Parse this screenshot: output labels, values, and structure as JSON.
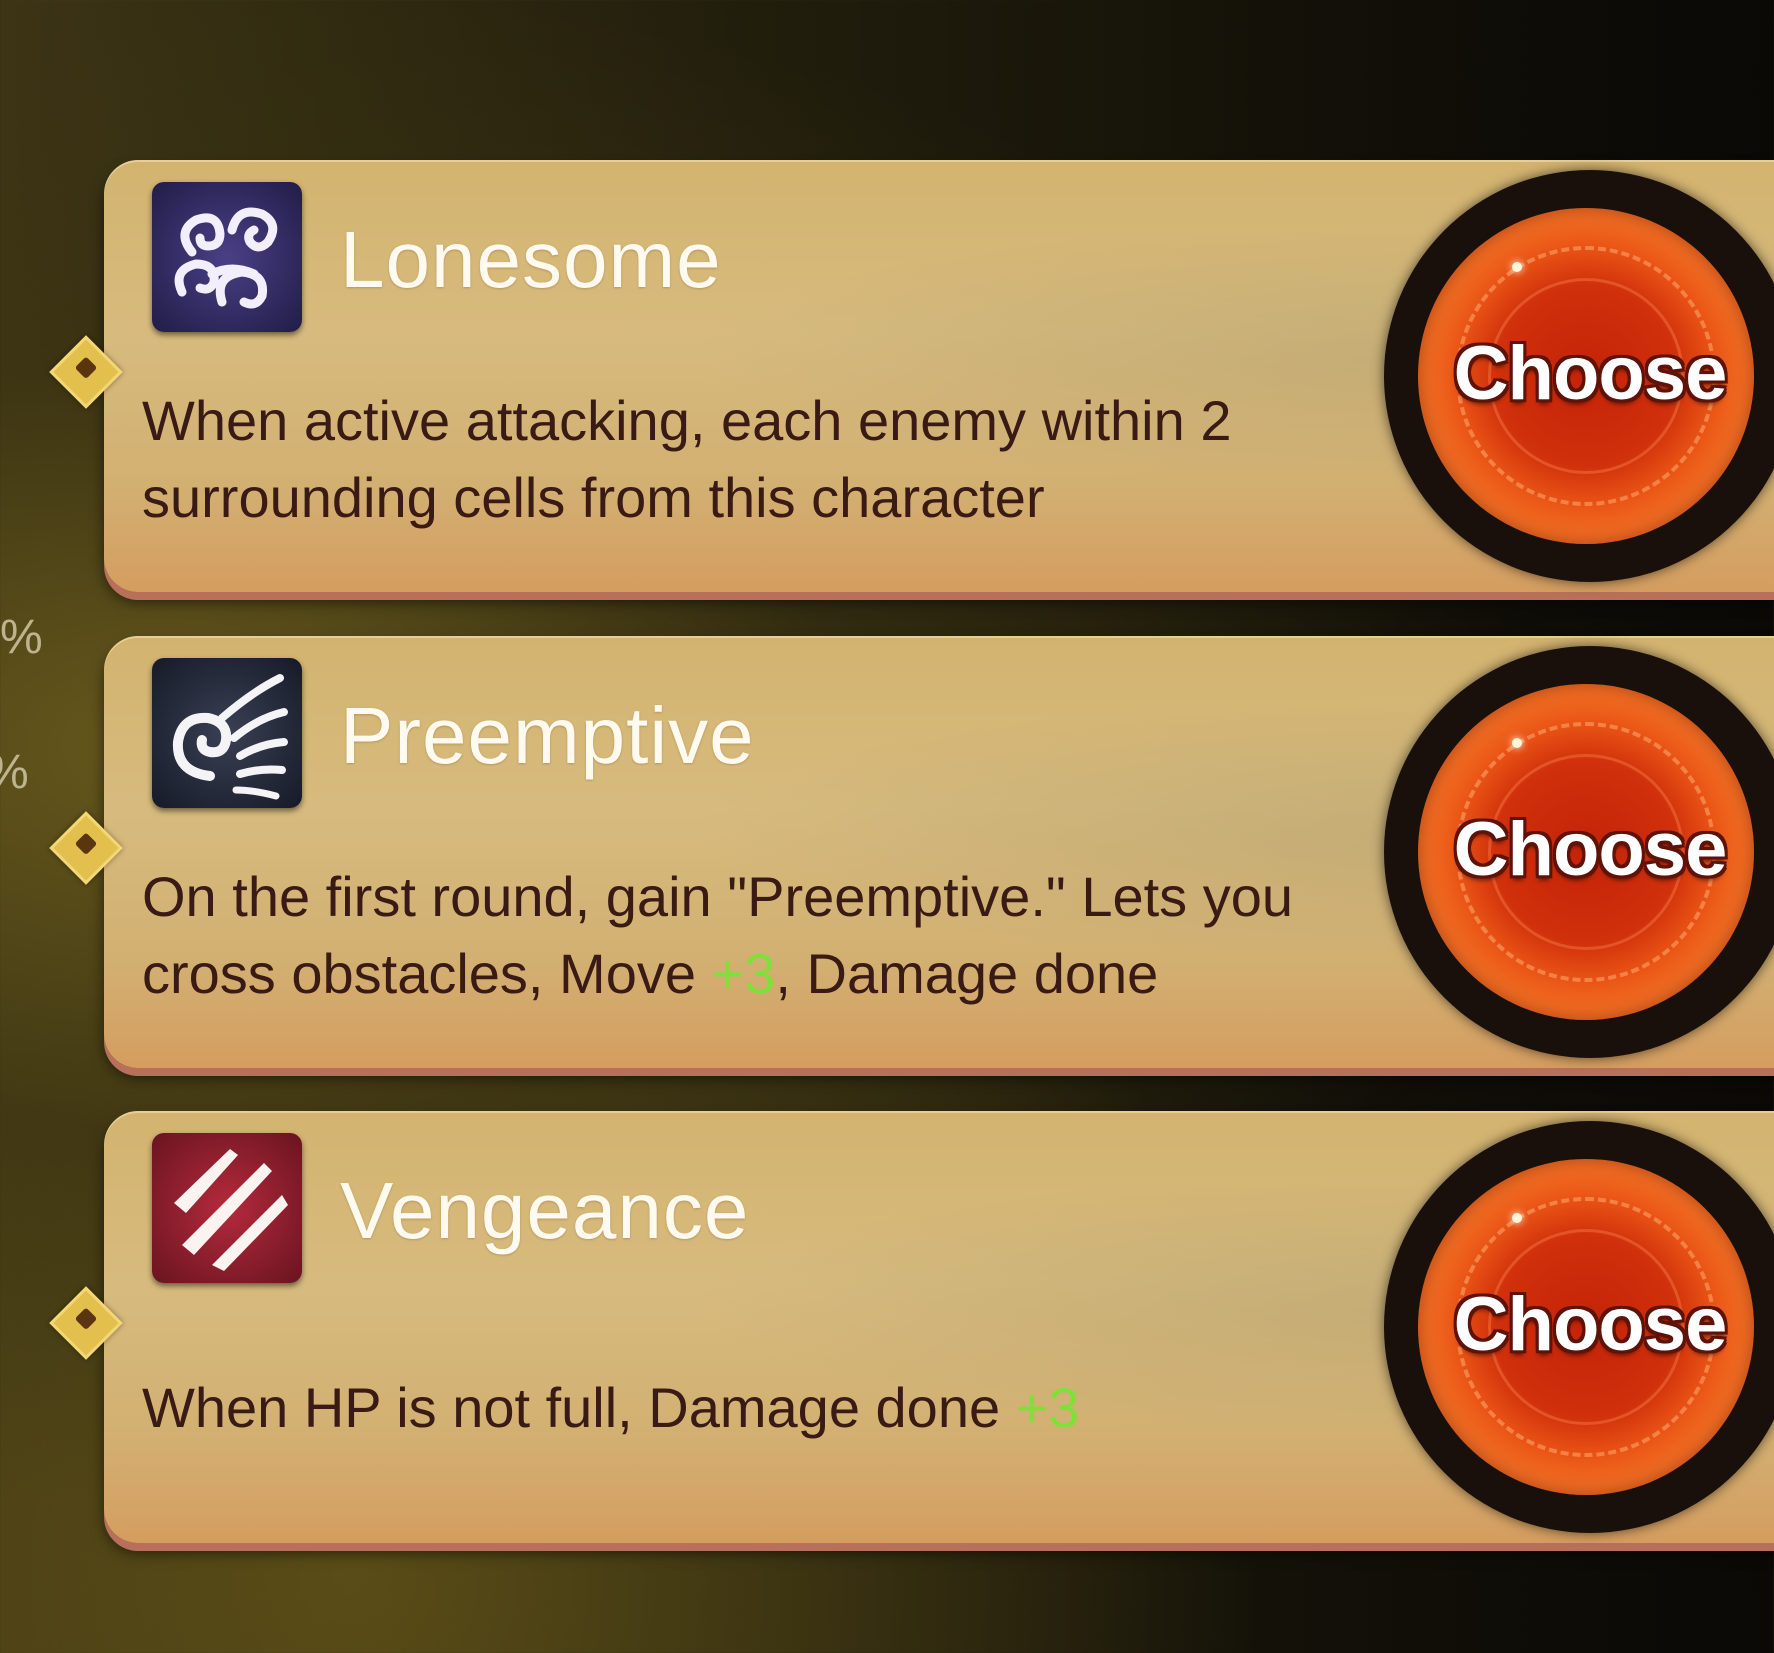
{
  "side_readouts": [
    "%",
    "%"
  ],
  "choices": [
    {
      "name": "Lonesome",
      "icon": "cloud-swirl-icon",
      "icon_bg": "#2f2a5a",
      "description": [
        {
          "text": "When active attacking, each enemy within 2 surrounding cells from this character"
        }
      ],
      "button_label": "Choose"
    },
    {
      "name": "Preemptive",
      "icon": "wing-swirl-icon",
      "icon_bg": "#1f2436",
      "description": [
        {
          "text": "On the first round, gain \"Preemptive.\" Lets you cross obstacles, Move "
        },
        {
          "text": "+3",
          "bonus": true
        },
        {
          "text": ", Damage done"
        }
      ],
      "button_label": "Choose"
    },
    {
      "name": "Vengeance",
      "icon": "claw-slash-icon",
      "icon_bg": "#8b1e2c",
      "description": [
        {
          "text": "When HP is not full, Damage done "
        },
        {
          "text": "+3",
          "bonus": true
        }
      ],
      "button_label": "Choose"
    }
  ],
  "colors": {
    "title_text": "#fffaf0",
    "description_text": "#3a1a14",
    "bonus_text": "#7fe03a",
    "button_fill": "#d0300b"
  }
}
